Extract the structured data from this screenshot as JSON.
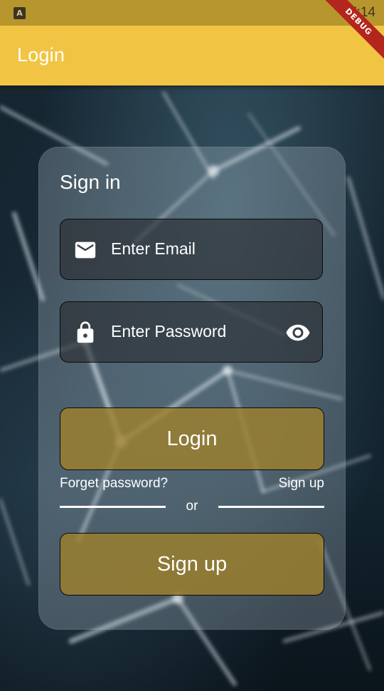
{
  "status_bar": {
    "app_icon_letter": "A",
    "time": "7:14"
  },
  "debug_banner": "DEBUG",
  "app_bar": {
    "title": "Login"
  },
  "card": {
    "title": "Sign in",
    "email_field": {
      "icon": "mail-icon",
      "placeholder": "Enter Email"
    },
    "password_field": {
      "icon": "lock-icon",
      "placeholder": "Enter Password",
      "toggle_icon": "eye-icon"
    },
    "login_button": "Login",
    "forgot_password_link": "Forget password?",
    "signup_link": "Sign up",
    "divider_text": "or",
    "signup_button": "Sign up"
  },
  "colors": {
    "app_bar": "#f1c543",
    "status_bar": "#b8962e",
    "button": "#9e802d",
    "debug_ribbon": "#b3261e"
  }
}
